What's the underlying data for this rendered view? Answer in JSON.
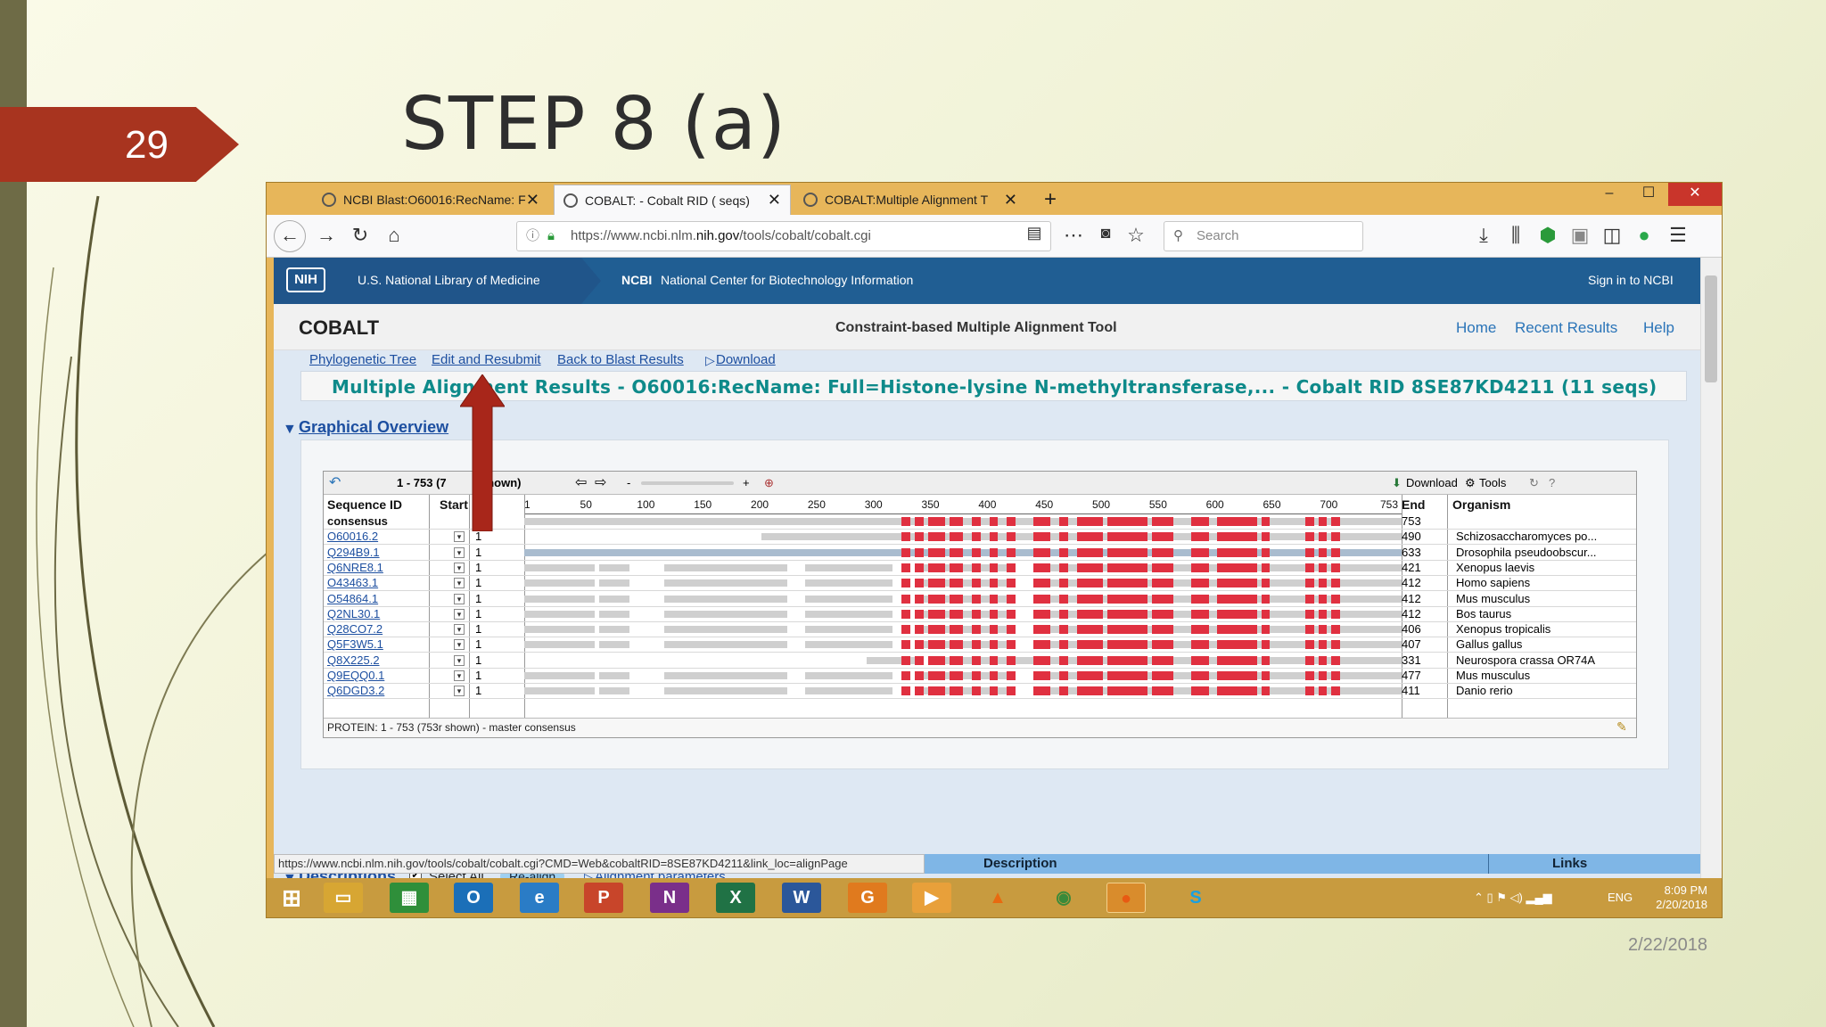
{
  "slide": {
    "number": "29",
    "title": "STEP 8 (a)",
    "date": "2/22/2018"
  },
  "browser": {
    "tabs": [
      {
        "label": "NCBI Blast:O60016:RecName: F"
      },
      {
        "label": "COBALT: - Cobalt RID ( seqs)"
      },
      {
        "label": "COBALT:Multiple Alignment T"
      }
    ],
    "new_tab": "+",
    "url_prefix": "https://www.ncbi.nlm.",
    "url_domain": "nih.gov",
    "url_suffix": "/tools/cobalt/cobalt.cgi",
    "search_placeholder": "Search",
    "window_controls": [
      "–",
      "☐",
      "✕"
    ]
  },
  "ncbi": {
    "nih_logo": "NIH",
    "library": "U.S. National Library of Medicine",
    "ncbi_abbr": "NCBI",
    "ncbi_full": "National Center for Biotechnology Information",
    "signin": "Sign in to NCBI",
    "app_title": "COBALT",
    "app_subtitle": "Constraint-based Multiple Alignment Tool",
    "top_links": [
      "Home",
      "Recent Results",
      "Help"
    ]
  },
  "results": {
    "links": [
      "Phylogenetic Tree",
      "Edit and Resubmit",
      "Back to Blast Results",
      "Download"
    ],
    "title": "Multiple Alignment Results - O60016:RecName: Full=Histone-lysine N-methyltransferase,... - Cobalt RID 8SE87KD4211 (11 seqs)",
    "graphical_overview": "Graphical Overview",
    "range_label": "1 - 753 (7",
    "range_shown": "shown)",
    "download_menu": "Download",
    "tools_menu": "Tools",
    "columns": {
      "seq_id": "Sequence ID",
      "start": "Start",
      "end": "End",
      "organism": "Organism"
    },
    "axis_ticks": [
      "1",
      "50",
      "100",
      "150",
      "200",
      "250",
      "300",
      "350",
      "400",
      "450",
      "500",
      "550",
      "600",
      "650",
      "700",
      "753"
    ],
    "rows": [
      {
        "id": "consensus",
        "start": "1",
        "end": "753",
        "organism": ""
      },
      {
        "id": "O60016.2",
        "start": "1",
        "end": "490",
        "organism": "Schizosaccharomyces po..."
      },
      {
        "id": "Q294B9.1",
        "start": "1",
        "end": "633",
        "organism": "Drosophila pseudoobscur..."
      },
      {
        "id": "Q6NRE8.1",
        "start": "1",
        "end": "421",
        "organism": "Xenopus laevis"
      },
      {
        "id": "O43463.1",
        "start": "1",
        "end": "412",
        "organism": "Homo sapiens"
      },
      {
        "id": "O54864.1",
        "start": "1",
        "end": "412",
        "organism": "Mus musculus"
      },
      {
        "id": "Q2NL30.1",
        "start": "1",
        "end": "412",
        "organism": "Bos taurus"
      },
      {
        "id": "Q28CO7.2",
        "start": "1",
        "end": "406",
        "organism": "Xenopus tropicalis"
      },
      {
        "id": "Q5F3W5.1",
        "start": "1",
        "end": "407",
        "organism": "Gallus gallus"
      },
      {
        "id": "Q8X225.2",
        "start": "1",
        "end": "331",
        "organism": "Neurospora crassa OR74A"
      },
      {
        "id": "Q9EQQ0.1",
        "start": "1",
        "end": "477",
        "organism": "Mus musculus"
      },
      {
        "id": "Q6DGD3.2",
        "start": "1",
        "end": "411",
        "organism": "Danio rerio"
      }
    ],
    "footer": "PROTEIN: 1 - 753 (753r shown) - master consensus",
    "descriptions": "Descriptions",
    "select_all": "Select All",
    "realign": "Re-align",
    "alignment_params": "Alignment parameters",
    "status_url": "https://www.ncbi.nlm.nih.gov/tools/cobalt/cobalt.cgi?CMD=Web&cobaltRID=8SE87KD4211&link_loc=alignPage",
    "desc_col": "Description",
    "links_col": "Links"
  },
  "taskbar": {
    "lang": "ENG",
    "time": "8:09 PM",
    "date": "2/20/2018"
  },
  "colors": {
    "accent_red": "#a8341f",
    "ncbi_blue": "#20558a",
    "alignment_red": "#e03040",
    "alignment_gray": "#c8c8c8"
  }
}
